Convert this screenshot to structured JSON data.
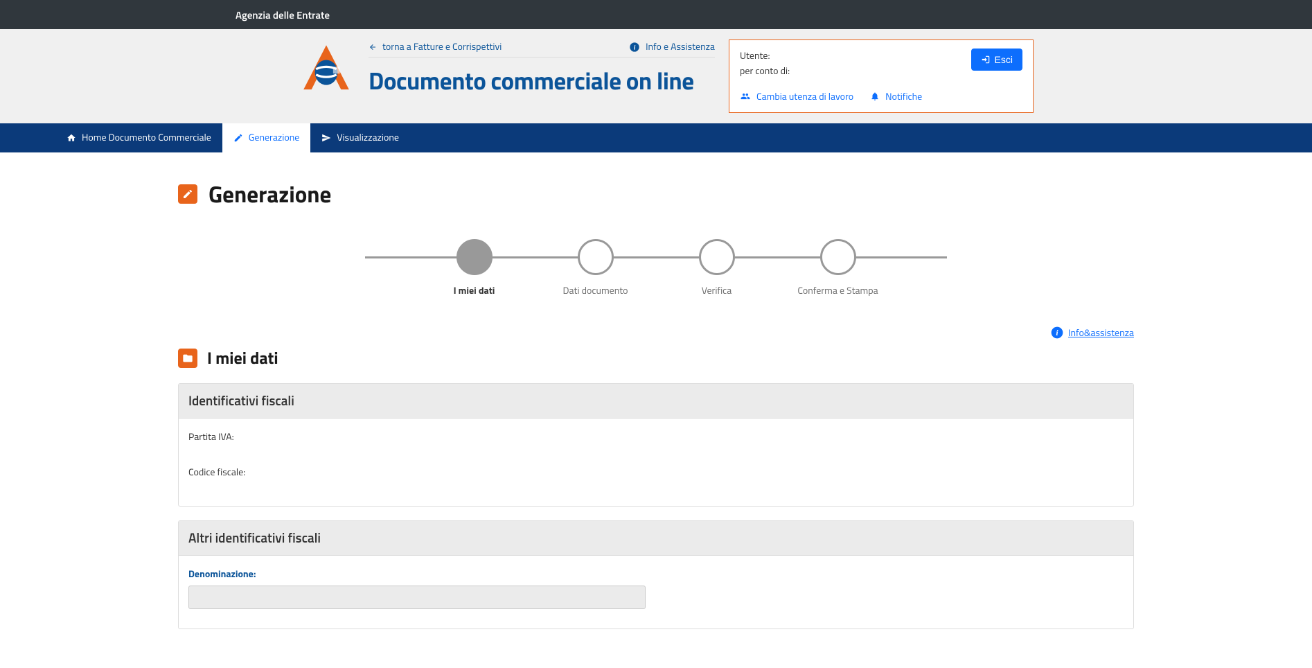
{
  "topBar": {
    "agency": "Agenzia delle Entrate"
  },
  "header": {
    "backLink": "torna a Fatture e Corrispettivi",
    "infoLink": "Info e Assistenza",
    "appTitle": "Documento commerciale on line"
  },
  "userBox": {
    "utenteLabel": "Utente:",
    "utenteValue": "",
    "perContoLabel": "per conto di:",
    "perContoValue": "",
    "esciLabel": "Esci",
    "cambiaUtenzaLabel": "Cambia utenza di lavoro",
    "notificheLabel": "Notifiche"
  },
  "nav": {
    "home": "Home Documento Commerciale",
    "generazione": "Generazione",
    "visualizzazione": "Visualizzazione"
  },
  "page": {
    "title": "Generazione",
    "assistLink": "Info&assistenza"
  },
  "stepper": {
    "step1": "I miei dati",
    "step2": "Dati documento",
    "step3": "Verifica",
    "step4": "Conferma e Stampa"
  },
  "sections": {
    "mieiDati": "I miei dati",
    "identificativiFiscali": {
      "title": "Identificativi fiscali",
      "partitaIvaLabel": "Partita IVA:",
      "partitaIvaValue": "",
      "codiceFiscaleLabel": "Codice fiscale:",
      "codiceFiscaleValue": ""
    },
    "altriIdentificativi": {
      "title": "Altri identificativi fiscali",
      "denominazioneLabel": "Denominazione:",
      "denominazioneValue": ""
    }
  }
}
